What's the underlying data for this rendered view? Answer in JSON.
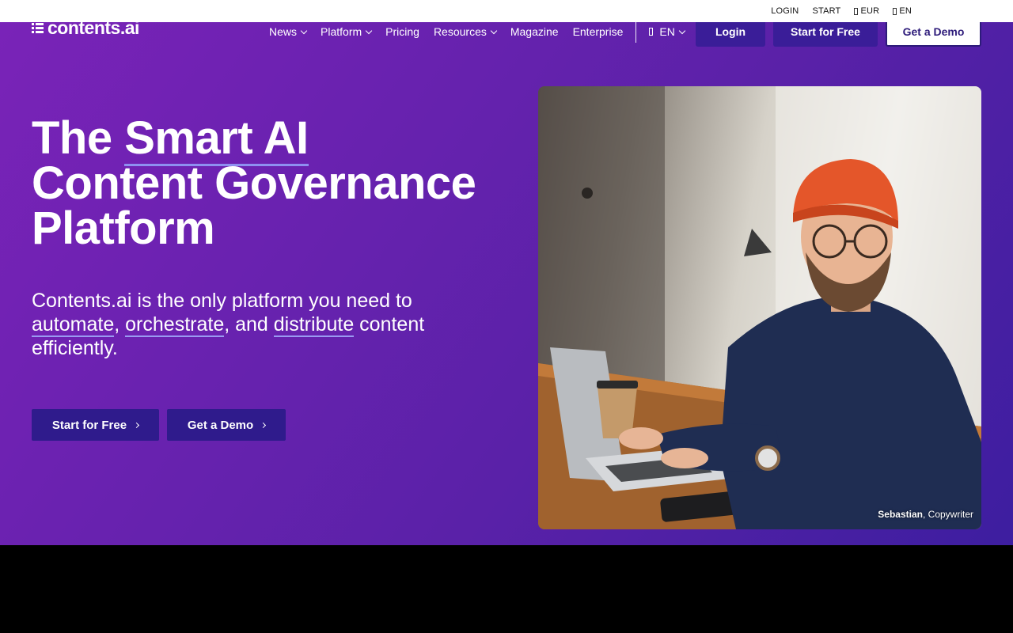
{
  "util_bar": {
    "login": "LOGIN",
    "start": "START",
    "currency": "EUR",
    "language": "EN"
  },
  "logo": {
    "text": "contents.ai"
  },
  "nav": {
    "items": [
      {
        "label": "News",
        "dropdown": true
      },
      {
        "label": "Platform",
        "dropdown": true
      },
      {
        "label": "Pricing",
        "dropdown": false
      },
      {
        "label": "Resources",
        "dropdown": true
      },
      {
        "label": "Magazine",
        "dropdown": false
      },
      {
        "label": "Enterprise",
        "dropdown": false
      }
    ],
    "language": "EN",
    "login_label": "Login",
    "start_label": "Start for Free",
    "demo_label": "Get a Demo"
  },
  "hero": {
    "headline_part1": "The ",
    "headline_highlight": "Smart AI",
    "headline_line2": "Content Governance",
    "headline_line3": "Platform",
    "sub_intro": "Contents.ai is the only platform you need to",
    "sub_link1": "automate",
    "sub_sep1": ", ",
    "sub_link2": "orchestrate",
    "sub_sep2": ", and ",
    "sub_link3": "distribute",
    "sub_outro": " content efficiently.",
    "cta_start": "Start for Free",
    "cta_demo": "Get a Demo"
  },
  "photo": {
    "caption_name": "Sebastian",
    "caption_role": ", Copywriter"
  },
  "colors": {
    "hero_start": "#7a23b8",
    "hero_end": "#3d1ea0",
    "button_dark": "#3a1d98",
    "underline": "#8e8ff0"
  }
}
